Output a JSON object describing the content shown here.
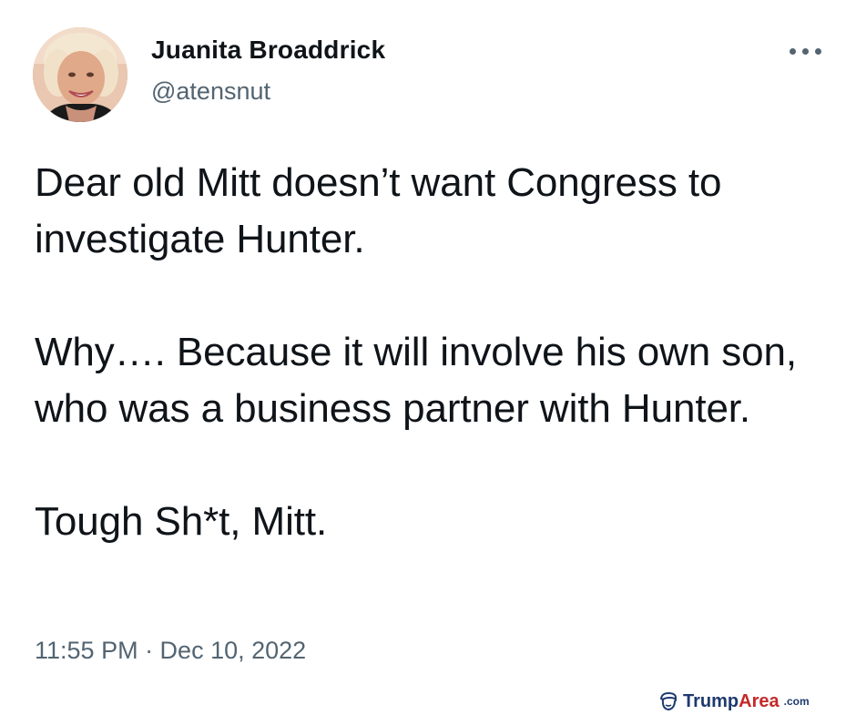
{
  "tweet": {
    "author_name": "Juanita Broaddrick",
    "author_handle": "@atensnut",
    "more_icon": "more-horizontal-icon",
    "body": {
      "p1": "Dear old Mitt doesn’t want Congress to investigate Hunter.",
      "p2": "Why…. Because it will involve his own son, who was a business partner with Hunter.",
      "p3": "Tough Sh*t, Mitt."
    },
    "timestamp": "11:55 PM · Dec 10, 2022"
  },
  "watermark": {
    "icon": "trump-head-icon",
    "part1": "Trump",
    "part2": "Area",
    "part3": ".com",
    "colors": {
      "trump": "#1e3a6e",
      "area": "#c62828"
    }
  },
  "colors": {
    "text": "#0f1419",
    "secondary": "#536471",
    "background": "#ffffff"
  }
}
